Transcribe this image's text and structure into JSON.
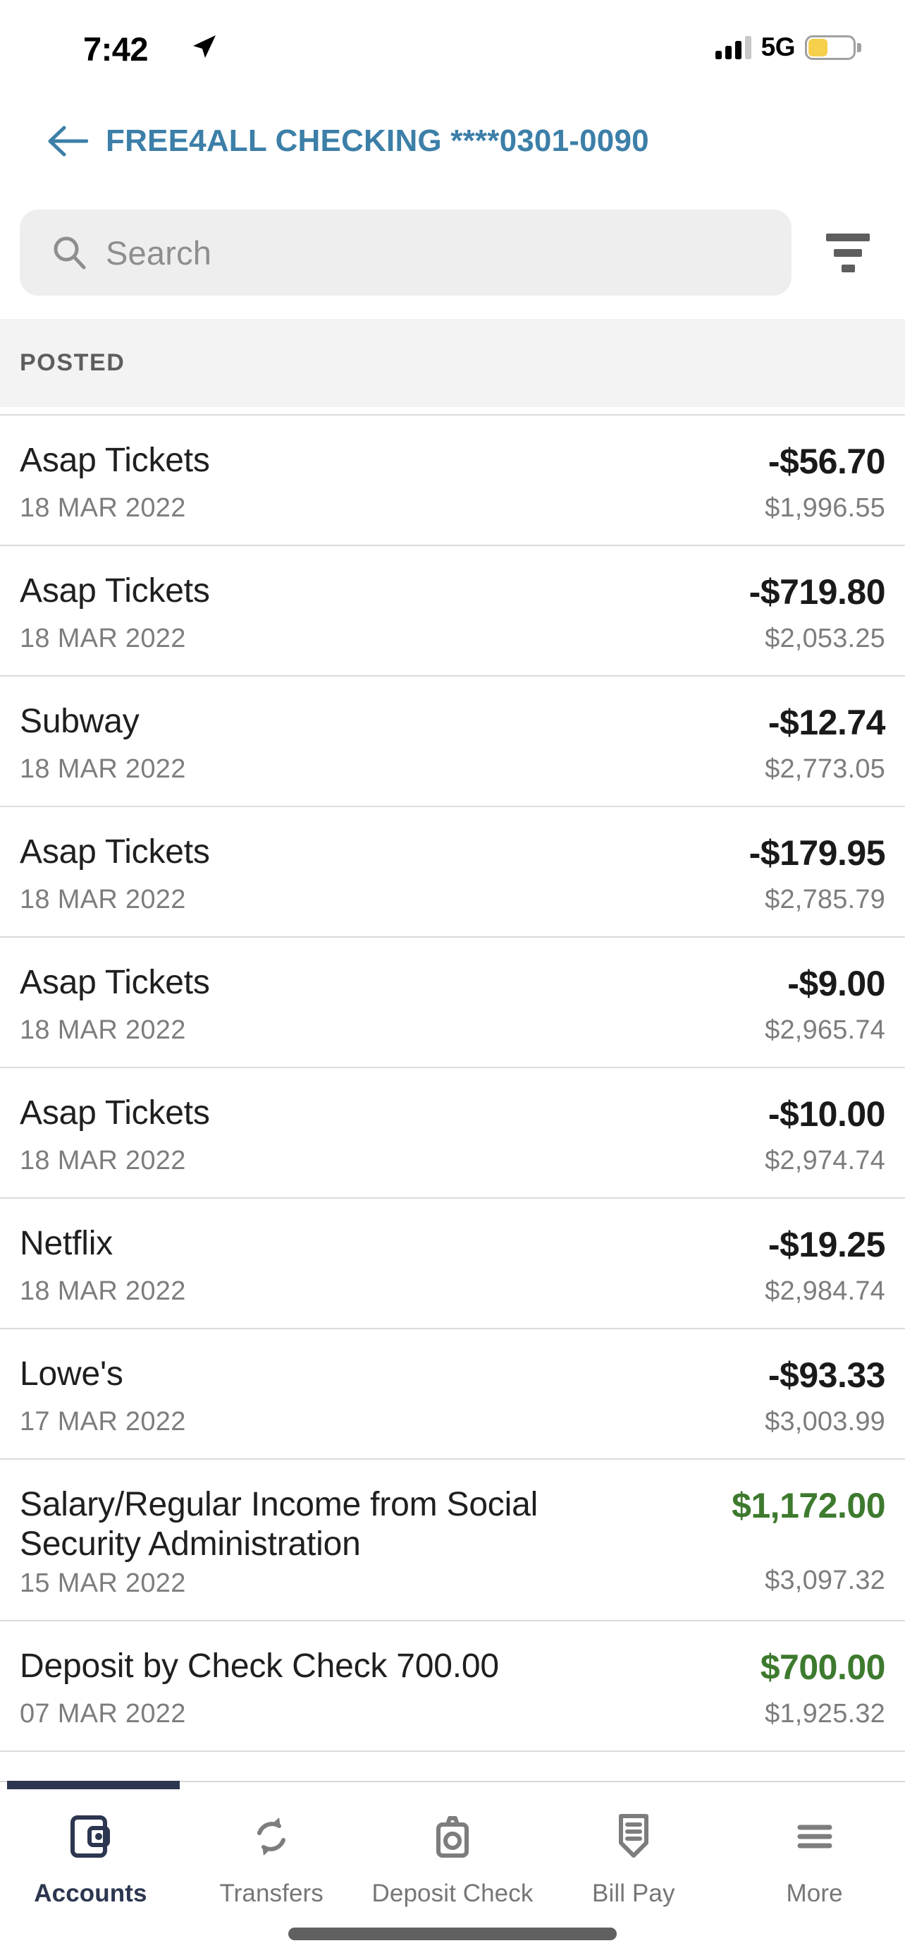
{
  "status_bar": {
    "time": "7:42",
    "location_icon": "location-arrow-icon",
    "signal_icon": "cellular-signal-icon",
    "network": "5G",
    "battery_icon": "battery-low-power-icon",
    "battery_level_percent": 38,
    "battery_color": "#f6cf4b"
  },
  "header": {
    "back_icon": "back-arrow-icon",
    "title": "FREE4ALL CHECKING ****0301-0090",
    "title_color": "#3c7fa8"
  },
  "search": {
    "icon": "search-icon",
    "placeholder": "Search",
    "value": "",
    "filter_icon": "filter-icon"
  },
  "section": {
    "posted_label": "POSTED"
  },
  "colors": {
    "negative_amount": "#1a1a1a",
    "positive_amount": "#3d7a2e",
    "accent_navy": "#2c3650",
    "muted_text": "#7d7d7d"
  },
  "transactions": [
    {
      "name": "Asap Tickets",
      "date": "18 MAR 2022",
      "amount": "-$56.70",
      "balance": "$1,996.55",
      "positive": false
    },
    {
      "name": "Asap Tickets",
      "date": "18 MAR 2022",
      "amount": "-$719.80",
      "balance": "$2,053.25",
      "positive": false
    },
    {
      "name": "Subway",
      "date": "18 MAR 2022",
      "amount": "-$12.74",
      "balance": "$2,773.05",
      "positive": false
    },
    {
      "name": "Asap Tickets",
      "date": "18 MAR 2022",
      "amount": "-$179.95",
      "balance": "$2,785.79",
      "positive": false
    },
    {
      "name": "Asap Tickets",
      "date": "18 MAR 2022",
      "amount": "-$9.00",
      "balance": "$2,965.74",
      "positive": false
    },
    {
      "name": "Asap Tickets",
      "date": "18 MAR 2022",
      "amount": "-$10.00",
      "balance": "$2,974.74",
      "positive": false
    },
    {
      "name": "Netflix",
      "date": "18 MAR 2022",
      "amount": "-$19.25",
      "balance": "$2,984.74",
      "positive": false
    },
    {
      "name": "Lowe's",
      "date": "17 MAR 2022",
      "amount": "-$93.33",
      "balance": "$3,003.99",
      "positive": false
    },
    {
      "name": "Salary/Regular Income from Social Security Administration",
      "date": "15 MAR 2022",
      "amount": "$1,172.00",
      "balance": "$3,097.32",
      "positive": true
    },
    {
      "name": "Deposit by Check Check 700.00",
      "date": "07 MAR 2022",
      "amount": "$700.00",
      "balance": "$1,925.32",
      "positive": true
    }
  ],
  "tabbar": {
    "items": [
      {
        "label": "Accounts",
        "icon": "wallet-icon",
        "active": true
      },
      {
        "label": "Transfers",
        "icon": "transfer-arrows-icon",
        "active": false
      },
      {
        "label": "Deposit Check",
        "icon": "camera-icon",
        "active": false
      },
      {
        "label": "Bill Pay",
        "icon": "bill-envelope-icon",
        "active": false
      },
      {
        "label": "More",
        "icon": "hamburger-menu-icon",
        "active": false
      }
    ]
  }
}
